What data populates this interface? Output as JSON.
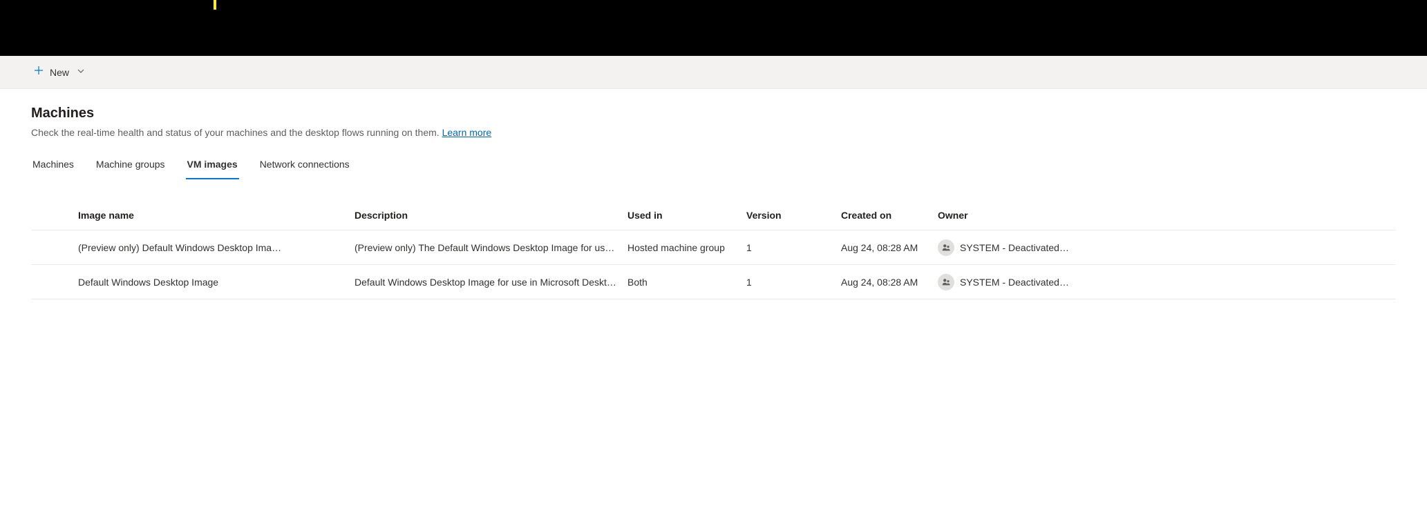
{
  "toolbar": {
    "new_label": "New"
  },
  "page": {
    "title": "Machines",
    "subtitle_prefix": "Check the real-time health and status of your machines and the desktop flows running on them. ",
    "learn_more": "Learn more"
  },
  "tabs": {
    "machines": "Machines",
    "machine_groups": "Machine groups",
    "vm_images": "VM images",
    "network_connections": "Network connections"
  },
  "table": {
    "headers": {
      "image_name": "Image name",
      "description": "Description",
      "used_in": "Used in",
      "version": "Version",
      "created_on": "Created on",
      "owner": "Owner"
    },
    "rows": [
      {
        "image_name": "(Preview only) Default Windows Desktop Ima…",
        "description": "(Preview only) The Default Windows Desktop Image for use i…",
        "used_in": "Hosted machine group",
        "version": "1",
        "created_on": "Aug 24, 08:28 AM",
        "owner": "SYSTEM - Deactivated…"
      },
      {
        "image_name": "Default Windows Desktop Image",
        "description": "Default Windows Desktop Image for use in Microsoft Deskto…",
        "used_in": "Both",
        "version": "1",
        "created_on": "Aug 24, 08:28 AM",
        "owner": "SYSTEM - Deactivated…"
      }
    ]
  }
}
